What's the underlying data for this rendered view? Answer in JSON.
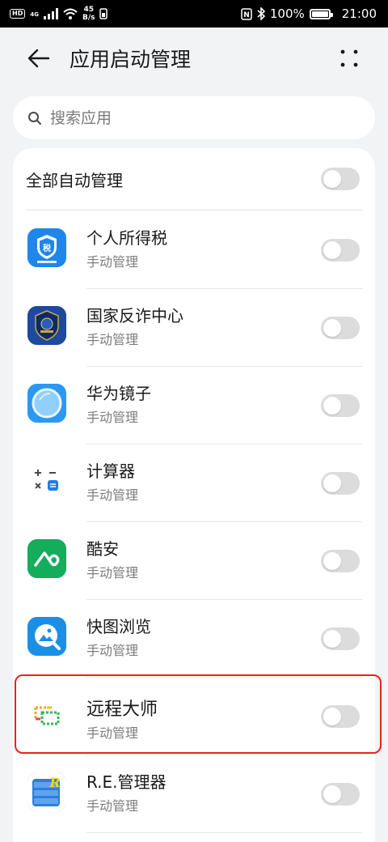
{
  "status_bar": {
    "hd": "HD",
    "network": "4G",
    "speed_value": "45",
    "speed_unit": "B/s",
    "battery": "100%",
    "time": "21:00"
  },
  "header": {
    "title": "应用启动管理"
  },
  "search": {
    "placeholder": "搜索应用"
  },
  "all_auto": {
    "label": "全部自动管理",
    "enabled": false
  },
  "apps": [
    {
      "name": "个人所得税",
      "status": "手动管理",
      "icon": "tax-app-icon",
      "enabled": false
    },
    {
      "name": "国家反诈中心",
      "status": "手动管理",
      "icon": "anti-fraud-app-icon",
      "enabled": false
    },
    {
      "name": "华为镜子",
      "status": "手动管理",
      "icon": "mirror-app-icon",
      "enabled": false
    },
    {
      "name": "计算器",
      "status": "手动管理",
      "icon": "calculator-app-icon",
      "enabled": false
    },
    {
      "name": "酷安",
      "status": "手动管理",
      "icon": "coolapk-app-icon",
      "enabled": false
    },
    {
      "name": "快图浏览",
      "status": "手动管理",
      "icon": "quickpic-app-icon",
      "enabled": false
    },
    {
      "name": "远程大师",
      "status": "手动管理",
      "icon": "remote-master-app-icon",
      "enabled": false
    },
    {
      "name": "R.E.管理器",
      "status": "手动管理",
      "icon": "re-manager-app-icon",
      "enabled": false
    }
  ],
  "colors": {
    "background": "#f1f3f5",
    "toggle_off": "#dcdcdc",
    "highlight": "#e8231f"
  }
}
